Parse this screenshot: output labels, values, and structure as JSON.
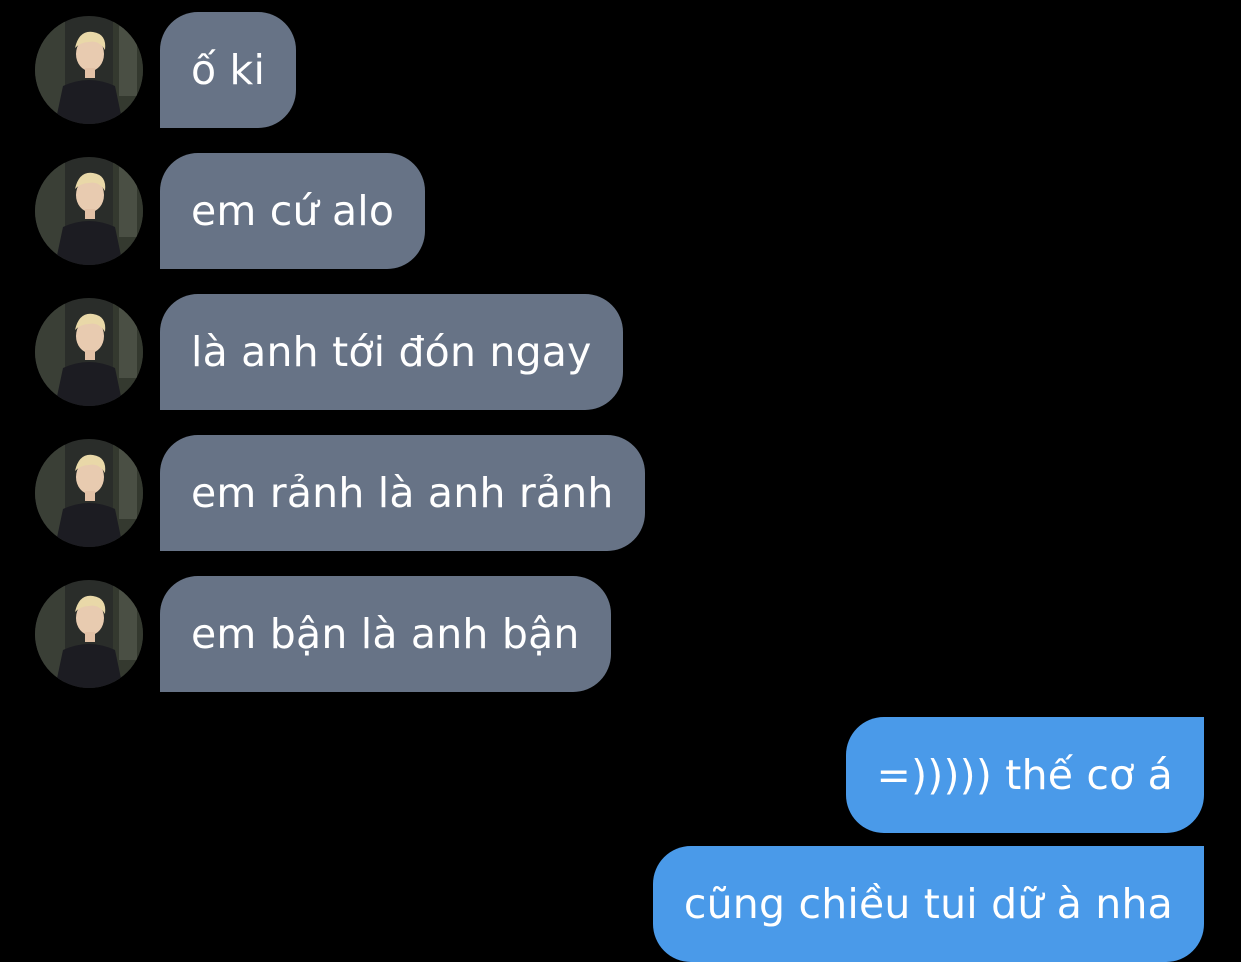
{
  "theme": {
    "background": "#000000",
    "incoming_bubble": "#677386",
    "outgoing_bubble": "#4a9ae9",
    "text": "#ffffff"
  },
  "messages": [
    {
      "direction": "incoming",
      "text": "ố ki",
      "avatar": "contact-photo-avatar"
    },
    {
      "direction": "incoming",
      "text": "em cứ alo",
      "avatar": "contact-photo-avatar"
    },
    {
      "direction": "incoming",
      "text": "là anh tới đón ngay",
      "avatar": "contact-photo-avatar"
    },
    {
      "direction": "incoming",
      "text": "em rảnh là anh rảnh",
      "avatar": "contact-photo-avatar"
    },
    {
      "direction": "incoming",
      "text": "em bận là anh bận",
      "avatar": "contact-photo-avatar"
    },
    {
      "direction": "outgoing",
      "text": "=))))) thế cơ á"
    },
    {
      "direction": "outgoing",
      "text": "cũng chiều tui dữ à nha"
    }
  ]
}
